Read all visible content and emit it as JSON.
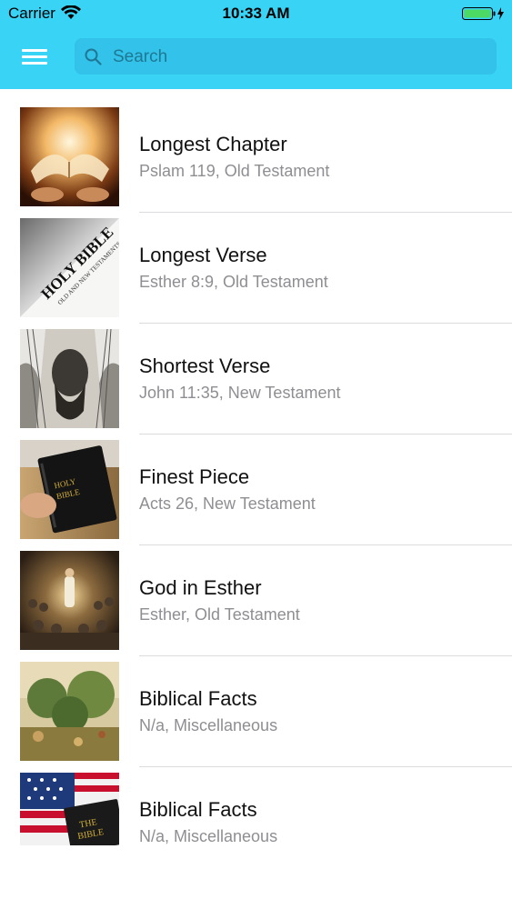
{
  "status_bar": {
    "carrier": "Carrier",
    "time": "10:33 AM"
  },
  "nav": {
    "search_placeholder": "Search"
  },
  "colors": {
    "header": "#38d3f5",
    "title": "#111111",
    "subtitle": "#8e8e93",
    "battery": "#4cd964"
  },
  "items": [
    {
      "title": "Longest Chapter",
      "subtitle": "Pslam 119, Old Testament",
      "image": "glowing-open-bible"
    },
    {
      "title": "Longest Verse",
      "subtitle": "Esther 8:9, Old Testament",
      "image": "holy-bible-page"
    },
    {
      "title": "Shortest Verse",
      "subtitle": "John 11:35, New Testament",
      "image": "weeping-man-sketch"
    },
    {
      "title": "Finest Piece",
      "subtitle": "Acts 26, New Testament",
      "image": "hand-holding-bible"
    },
    {
      "title": "God in Esther",
      "subtitle": "Esther, Old Testament",
      "image": "crowd-painting"
    },
    {
      "title": "Biblical Facts",
      "subtitle": "N/a, Miscellaneous",
      "image": "garden-painting"
    },
    {
      "title": "Biblical Facts",
      "subtitle": "N/a, Miscellaneous",
      "image": "flag-and-bible"
    }
  ]
}
